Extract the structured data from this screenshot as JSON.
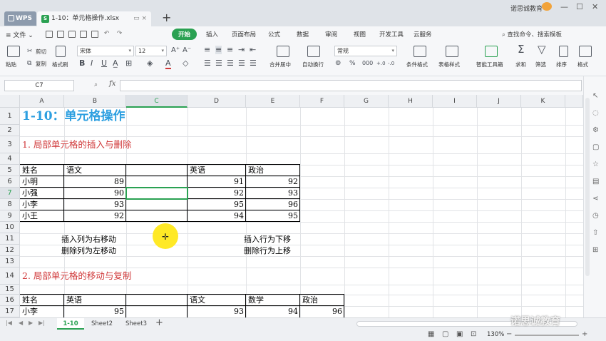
{
  "titlebar": {
    "app_tab": "WPS",
    "doc_tab": "1-10：单元格操作.xlsx",
    "new_tab": "+",
    "user": "诺思诚教育"
  },
  "menubar": {
    "file": "文件",
    "tabs": [
      "开始",
      "插入",
      "页面布局",
      "公式",
      "数据",
      "审阅",
      "视图",
      "开发工具",
      "云服务"
    ],
    "active_tab": "开始",
    "search": "查找命令、搜索模板"
  },
  "ribbon": {
    "cut": "剪切",
    "copy": "复制",
    "paste": "粘贴",
    "format_painter": "格式刷",
    "font_name": "宋体",
    "font_size": "12",
    "merge_center": "合并居中",
    "wrap_text": "自动换行",
    "number_format": "常规",
    "conditional_format": "条件格式",
    "table_style": "表格样式",
    "smart_toolbox": "智能工具箱",
    "sum": "求和",
    "filter": "筛选",
    "sort": "排序",
    "format": "格式"
  },
  "formula": {
    "name_box": "C7",
    "fx": "fx",
    "value": ""
  },
  "grid": {
    "columns": [
      "A",
      "B",
      "C",
      "D",
      "E",
      "F",
      "G",
      "H",
      "I",
      "J",
      "K"
    ],
    "selected_column": "C",
    "rows": [
      "1",
      "2",
      "3",
      "4",
      "5",
      "6",
      "7",
      "8",
      "9",
      "10",
      "11",
      "12",
      "13",
      "14",
      "15",
      "16",
      "17"
    ],
    "selected_row": "7",
    "selected_cell": "C7",
    "title": "1-10：单元格操作",
    "section1": "1. 局部单元格的插入与删除",
    "table1": {
      "headers": [
        "姓名",
        "语文",
        "",
        "英语",
        "政治"
      ],
      "rows": [
        [
          "小明",
          "89",
          "",
          "91",
          "92"
        ],
        [
          "小强",
          "90",
          "",
          "92",
          "93"
        ],
        [
          "小李",
          "93",
          "",
          "95",
          "96"
        ],
        [
          "小王",
          "92",
          "",
          "94",
          "95"
        ]
      ]
    },
    "notes": {
      "insert_col": "插入列为右移动",
      "delete_col": "删除列为左移动",
      "insert_row": "插入行为下移",
      "delete_row": "删除行为上移"
    },
    "section2": "2. 局部单元格的移动与复制",
    "table2": {
      "headers": [
        "姓名",
        "英语",
        "",
        "语文",
        "数学",
        "政治"
      ],
      "rows": [
        [
          "小李",
          "95",
          "",
          "93",
          "94",
          "96"
        ]
      ]
    }
  },
  "sheets": {
    "tabs": [
      "1-10",
      "Sheet2",
      "Sheet3"
    ],
    "active": "1-10",
    "add": "+"
  },
  "status": {
    "zoom": "130%"
  },
  "watermark": "诺思诚教育"
}
